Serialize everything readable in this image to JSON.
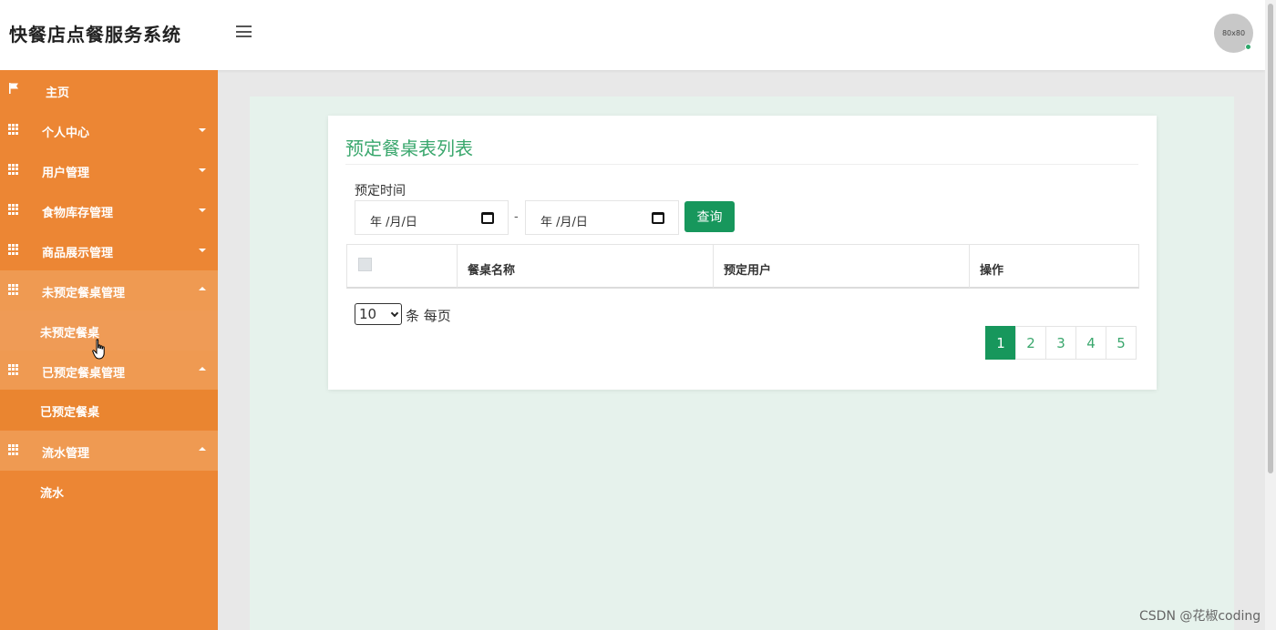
{
  "app": {
    "title": "快餐店点餐服务系统",
    "avatar_text": "80x80"
  },
  "sidebar": {
    "items": [
      {
        "label": "主页"
      },
      {
        "label": "个人中心"
      },
      {
        "label": "用户管理"
      },
      {
        "label": "食物库存管理"
      },
      {
        "label": "商品展示管理"
      },
      {
        "label": "未预定餐桌管理",
        "children": [
          {
            "label": "未预定餐桌"
          }
        ]
      },
      {
        "label": "已预定餐桌管理",
        "children": [
          {
            "label": "已预定餐桌"
          }
        ]
      },
      {
        "label": "流水管理",
        "children": [
          {
            "label": "流水"
          }
        ]
      }
    ]
  },
  "main": {
    "title": "预定餐桌表列表",
    "filter": {
      "label": "预定时间",
      "start_date_placeholder": "年 /月/日",
      "separator": "-",
      "end_date_placeholder": "年 /月/日",
      "query_label": "查询"
    },
    "table": {
      "columns": [
        "餐桌名称",
        "预定用户",
        "操作"
      ]
    },
    "pagination": {
      "page_size": "10",
      "per_page_label": "条 每页",
      "pages": [
        "1",
        "2",
        "3",
        "4",
        "5"
      ],
      "current_page": "1"
    }
  },
  "watermark": "CSDN @花椒coding",
  "colors": {
    "sidebar": "#ec8634",
    "accent": "#17975c",
    "title": "#3aa76d",
    "content_bg": "#e6f2ec"
  }
}
